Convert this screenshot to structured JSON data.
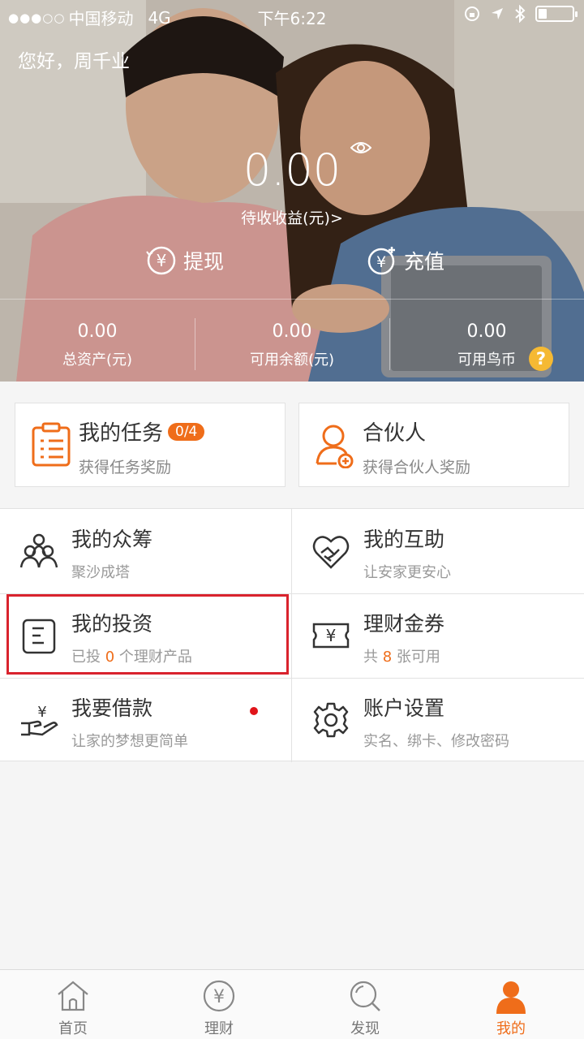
{
  "status_bar": {
    "carrier": "中国移动",
    "network": "4G",
    "time": "下午6:22"
  },
  "hero": {
    "greeting": "您好，周千业",
    "amount": "0.00",
    "amount_label": "待收收益(元)>",
    "withdraw_label": "提现",
    "recharge_label": "充值",
    "stats": [
      {
        "value": "0.00",
        "label": "总资产(元)"
      },
      {
        "value": "0.00",
        "label": "可用余额(元)"
      },
      {
        "value": "0.00",
        "label": "可用鸟币"
      }
    ],
    "help_glyph": "?"
  },
  "cards": {
    "tasks": {
      "title": "我的任务",
      "badge": "0/4",
      "subtitle": "获得任务奖励"
    },
    "partner": {
      "title": "合伙人",
      "subtitle": "获得合伙人奖励"
    }
  },
  "grid": {
    "crowdfunding": {
      "title": "我的众筹",
      "subtitle": "聚沙成塔"
    },
    "mutual_aid": {
      "title": "我的互助",
      "subtitle": "让安家更安心"
    },
    "investment": {
      "title": "我的投资",
      "sub_prefix": "已投",
      "count": "0",
      "sub_suffix": "个理财产品"
    },
    "coupons": {
      "title": "理财金券",
      "sub_prefix": "共",
      "count": "8",
      "sub_suffix": "张可用"
    },
    "loan": {
      "title": "我要借款",
      "subtitle": "让家的梦想更简单"
    },
    "settings": {
      "title": "账户设置",
      "subtitle": "实名、绑卡、修改密码"
    }
  },
  "tabbar": {
    "items": [
      {
        "label": "首页",
        "icon": "home-icon"
      },
      {
        "label": "理财",
        "icon": "yen-circle-icon"
      },
      {
        "label": "发现",
        "icon": "search-icon"
      },
      {
        "label": "我的",
        "icon": "person-icon"
      }
    ],
    "active_index": 3
  },
  "colors": {
    "accent": "#ef6d1a",
    "highlight_border": "#d9232d",
    "help_badge": "#f5b933"
  }
}
